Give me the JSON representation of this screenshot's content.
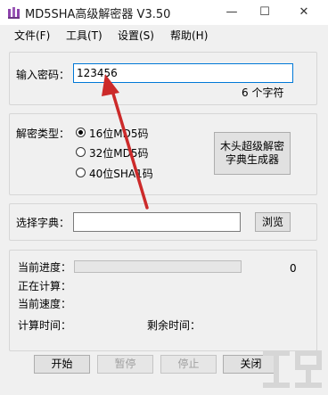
{
  "window": {
    "title": "MD5SHA高级解密器 V3.50",
    "minimize": "—",
    "maximize": "☐",
    "close": "✕"
  },
  "menu": [
    {
      "label": "文件(F)"
    },
    {
      "label": "工具(T)"
    },
    {
      "label": "设置(S)"
    },
    {
      "label": "帮助(H)"
    }
  ],
  "password": {
    "label": "输入密码：",
    "value": "123456",
    "count_text": "6  个字符"
  },
  "decrypt": {
    "label": "解密类型：",
    "options": [
      {
        "label": "16位MD5码",
        "checked": true
      },
      {
        "label": "32位MD5码",
        "checked": false
      },
      {
        "label": "40位SHA1码",
        "checked": false
      }
    ],
    "generator_button": [
      "木头超级解密",
      "字典生成器"
    ]
  },
  "dictionary": {
    "label": "选择字典：",
    "value": "",
    "browse": "浏览"
  },
  "status": {
    "progress_label": "当前进度：",
    "progress_value": "0",
    "computing_label": "正在计算：",
    "speed_label": "当前速度：",
    "time_label": "计算时间：",
    "remain_label": "剩余时间："
  },
  "actions": {
    "start": "开始",
    "pause": "暂停",
    "stop": "停止",
    "close": "关闭"
  },
  "colors": {
    "accent_blue": "#0078d7",
    "arrow_red": "#cc2a2a"
  }
}
